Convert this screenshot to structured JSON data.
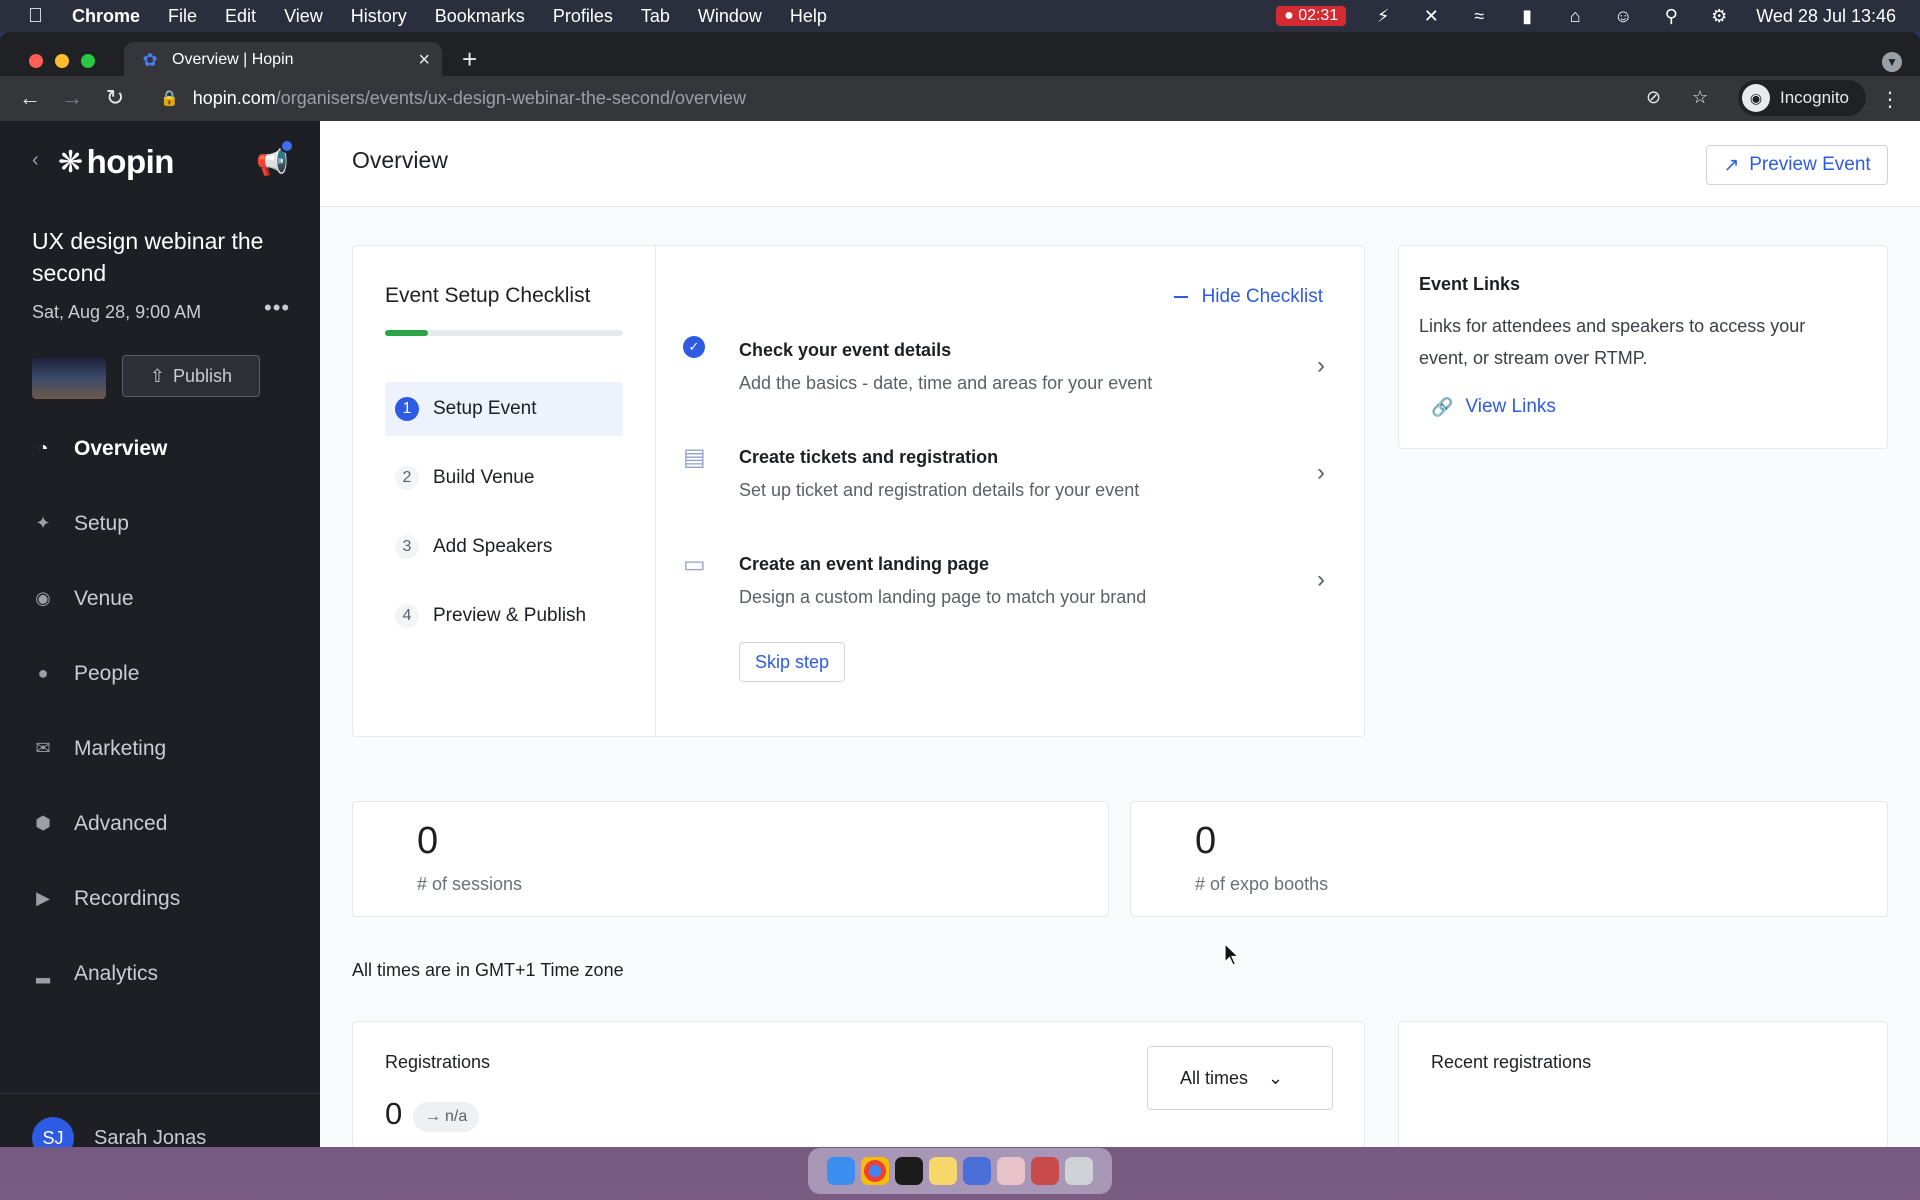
{
  "menubar": {
    "app": "Chrome",
    "items": [
      "File",
      "Edit",
      "View",
      "History",
      "Bookmarks",
      "Profiles",
      "Tab",
      "Window",
      "Help"
    ],
    "record_time": "02:31",
    "datetime": "Wed 28 Jul  13:46"
  },
  "browser": {
    "tab_title": "Overview | Hopin",
    "url_host": "hopin.com",
    "url_path": "/organisers/events/ux-design-webinar-the-second/overview",
    "incognito_label": "Incognito"
  },
  "sidebar": {
    "logo": "hopin",
    "event_title": "UX design webinar the second",
    "event_date": "Sat, Aug 28, 9:00 AM",
    "more": "•••",
    "publish_label": "Publish",
    "nav": [
      {
        "label": "Overview",
        "icon": "pie-chart-icon",
        "active": true
      },
      {
        "label": "Setup",
        "icon": "magic-wand-icon",
        "active": false
      },
      {
        "label": "Venue",
        "icon": "location-icon",
        "active": false
      },
      {
        "label": "People",
        "icon": "people-icon",
        "active": false
      },
      {
        "label": "Marketing",
        "icon": "mail-icon",
        "active": false
      },
      {
        "label": "Advanced",
        "icon": "hexagon-gear-icon",
        "active": false
      },
      {
        "label": "Recordings",
        "icon": "recording-icon",
        "active": false
      },
      {
        "label": "Analytics",
        "icon": "bar-chart-icon",
        "active": false
      }
    ],
    "user": {
      "initials": "SJ",
      "name": "Sarah Jonas"
    }
  },
  "main": {
    "title": "Overview",
    "preview_label": "Preview Event",
    "checklist": {
      "title": "Event Setup Checklist",
      "progress": 0.18,
      "hide_label": "Hide Checklist",
      "steps": [
        {
          "num": "1",
          "label": "Setup Event",
          "active": true
        },
        {
          "num": "2",
          "label": "Build Venue",
          "active": false
        },
        {
          "num": "3",
          "label": "Add Speakers",
          "active": false
        },
        {
          "num": "4",
          "label": "Preview & Publish",
          "active": false
        }
      ],
      "tasks": [
        {
          "title": "Check your event details",
          "subtitle": "Add the basics - date, time and areas for your event",
          "done": true
        },
        {
          "title": "Create tickets and registration",
          "subtitle": "Set up ticket and registration details for your event",
          "done": false
        },
        {
          "title": "Create an event landing page",
          "subtitle": "Design a custom landing page to match your brand",
          "done": false
        }
      ],
      "skip_label": "Skip step"
    },
    "links": {
      "title": "Event Links",
      "description": "Links for attendees and speakers to access your event, or stream over RTMP.",
      "view_label": "View Links"
    },
    "stats": [
      {
        "value": "0",
        "label": "# of sessions"
      },
      {
        "value": "0",
        "label": "# of expo booths"
      }
    ],
    "timezone_note": "All times are in GMT+1 Time zone",
    "registrations": {
      "title": "Registrations",
      "value": "0",
      "change": "n/a",
      "range_label": "All times"
    },
    "recent_title": "Recent registrations"
  },
  "colors": {
    "accent": "#2d5be3",
    "sidebar_bg": "#1d1f24",
    "progress": "#2aa34b"
  }
}
